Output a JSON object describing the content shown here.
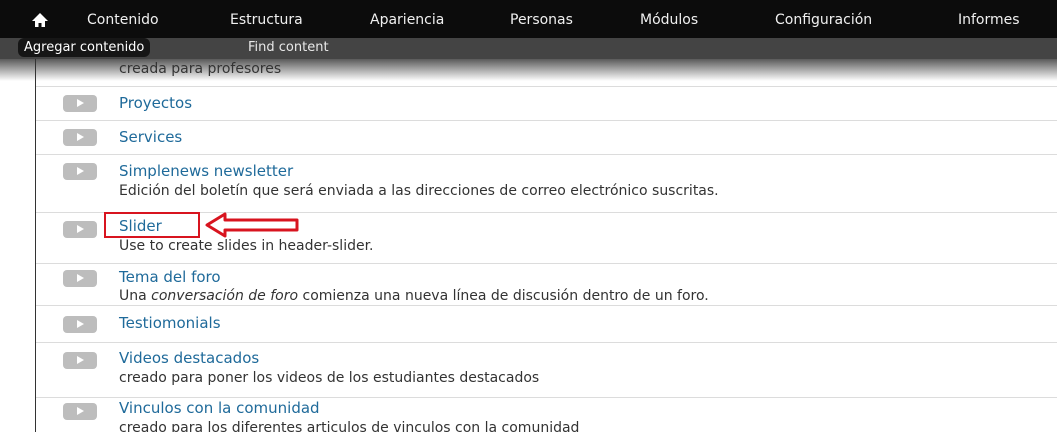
{
  "toolbar": {
    "menu": [
      "Contenido",
      "Estructura",
      "Apariencia",
      "Personas",
      "Módulos",
      "Configuración",
      "Informes"
    ],
    "home_icon": "home-icon"
  },
  "shortcuts": {
    "items": [
      "Agregar contenido",
      "Find content"
    ]
  },
  "content_types": {
    "partial_desc": "creada para profesores",
    "items": [
      {
        "title": "Proyectos",
        "description": ""
      },
      {
        "title": "Services",
        "description": ""
      },
      {
        "title": "Simplenews newsletter",
        "description": "Edición del boletín que será enviada a las direcciones de correo electrónico suscritas."
      },
      {
        "title": "Slider",
        "description": "Use to create slides in header-slider."
      },
      {
        "title": "Tema del foro",
        "description_prefix": "Una ",
        "description_em": "conversación de foro",
        "description_suffix": " comienza una nueva línea de discusión dentro de un foro."
      },
      {
        "title": "Testiomonials",
        "description": ""
      },
      {
        "title": "Videos destacados",
        "description": "creado para poner los videos de los estudiantes destacados"
      },
      {
        "title": "Vinculos con la comunidad",
        "description": "creado para los diferentes articulos de vinculos con la comunidad"
      }
    ]
  },
  "annotation": {
    "highlight_color": "#d8141f"
  }
}
